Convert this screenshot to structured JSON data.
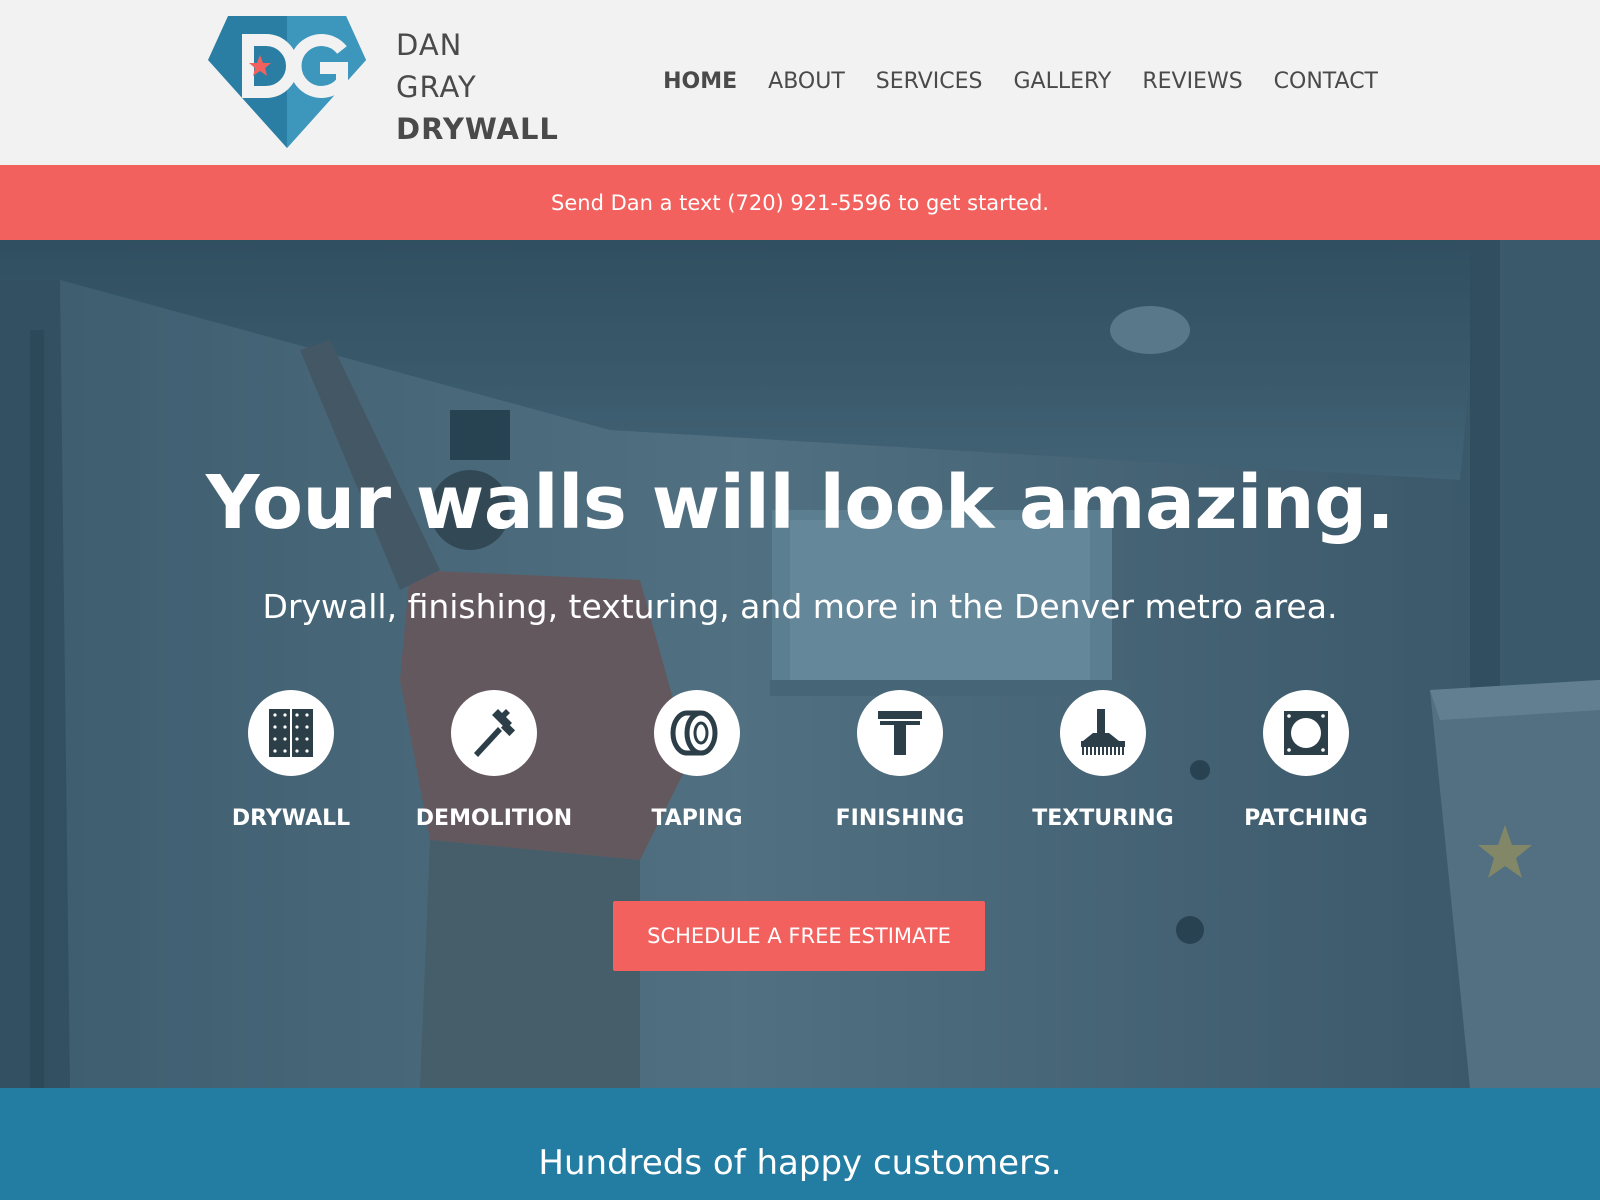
{
  "brand": {
    "monogram": "DG",
    "name_line1": "DAN",
    "name_line2": "GRAY",
    "name_line3": "DRYWALL",
    "colors": {
      "blue": "#2a7ea3",
      "blue_light": "#3d97bd",
      "red": "#f2615e"
    }
  },
  "nav": {
    "items": [
      {
        "label": "HOME",
        "active": true
      },
      {
        "label": "ABOUT",
        "active": false
      },
      {
        "label": "SERVICES",
        "active": false
      },
      {
        "label": "GALLERY",
        "active": false
      },
      {
        "label": "REVIEWS",
        "active": false
      },
      {
        "label": "CONTACT",
        "active": false
      }
    ]
  },
  "announcement": {
    "text": "Send Dan a text (720) 921-5596 to get started."
  },
  "hero": {
    "title": "Your walls will look amazing.",
    "subtitle": "Drywall, finishing, texturing, and more in the Denver metro area.",
    "services": [
      {
        "label": "DRYWALL",
        "icon": "drywall-panel-icon"
      },
      {
        "label": "DEMOLITION",
        "icon": "hammer-icon"
      },
      {
        "label": "TAPING",
        "icon": "tape-roll-icon"
      },
      {
        "label": "FINISHING",
        "icon": "trowel-icon"
      },
      {
        "label": "TEXTURING",
        "icon": "texture-brush-icon"
      },
      {
        "label": "PATCHING",
        "icon": "patch-icon"
      }
    ],
    "cta_label": "SCHEDULE A FREE ESTIMATE"
  },
  "customers": {
    "heading": "Hundreds of happy customers."
  }
}
